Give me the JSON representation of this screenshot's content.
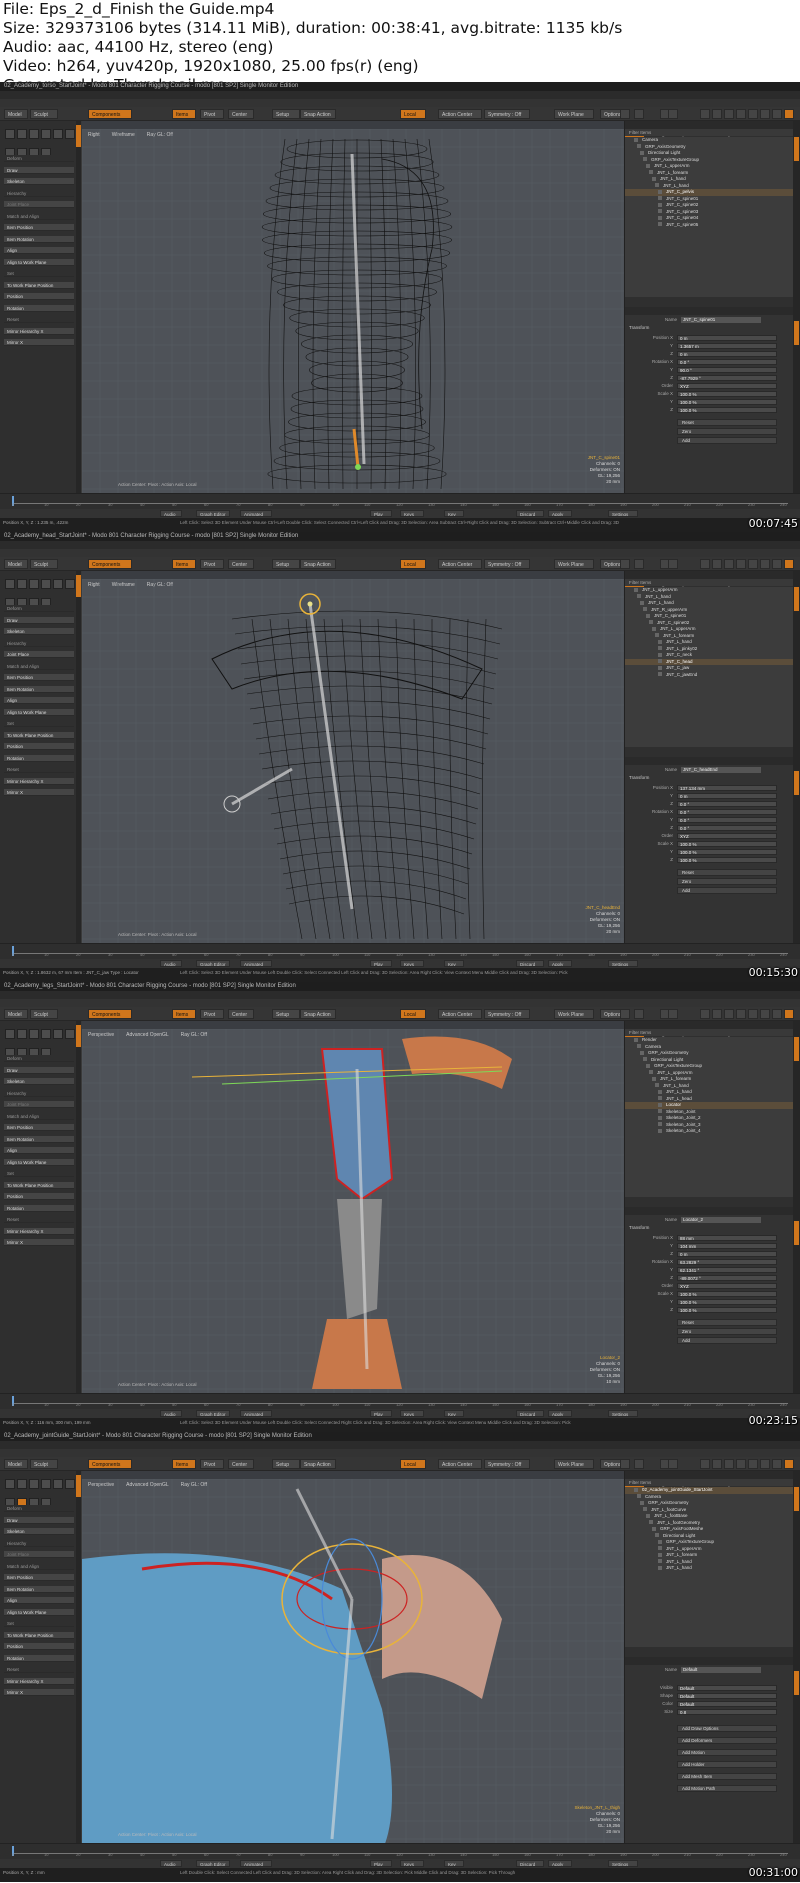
{
  "header": {
    "lines": [
      "File: Eps_2_d_Finish the Guide.mp4",
      "Size: 329373106 bytes (314.11 MiB), duration: 00:38:41, avg.bitrate: 1135 kb/s",
      "Audio: aac, 44100 Hz, stereo (eng)",
      "Video: h264, yuv420p, 1920x1080, 25.00 fps(r) (eng)",
      "Generated by Thumbnail me"
    ]
  },
  "app": {
    "menu": [
      "File",
      "Edit",
      "View",
      "Select",
      "Item",
      "Geometry",
      "Texture",
      "Vertex Map",
      "Animate",
      "Dynamics",
      "Render",
      "MTK",
      "Layout",
      "System",
      "Help"
    ],
    "layout_tabs": [
      "Model",
      "Model Quad",
      "Topo",
      "UV",
      "Paint",
      "Sculpt",
      "Setup",
      "Animate",
      "Render"
    ],
    "toolbar": {
      "model": "Model",
      "sculpt": "Sculpt",
      "components": "Components",
      "items": "Items",
      "pivot": "Pivot",
      "center": "Center",
      "setup": "Setup",
      "snap": "Snap Action",
      "actr": "Action Center",
      "local": "Local",
      "symmetry": "Symmetry : Off",
      "work_plane": "Work Plane",
      "options": "Options"
    },
    "toolpanel": [
      "Deform",
      "Draw",
      "Skeleton",
      "Hierarchy",
      "Joint Place",
      "Match and Align",
      "Item Position",
      "Item Rotation",
      "Align",
      "Align to Work Plane",
      "Set",
      "To Work Plane Position",
      "Position",
      "Rotation",
      "Reset",
      "Mirror Hierarchy X",
      "Mirror X"
    ],
    "right_tabs": [
      "Items",
      "Shading",
      "Groups",
      "Info",
      "Assembly"
    ],
    "prop_tabs": [
      "Properties",
      "Channels",
      "Display",
      "User",
      "Assembly"
    ],
    "filter_label": "Filter Items",
    "transform_label": "Transform",
    "name_label": "Name",
    "prop_labels": [
      "Position X",
      "Y",
      "Z",
      "Rotation X",
      "Y",
      "Z",
      "Order",
      "Scale X",
      "Y",
      "Z"
    ],
    "buttons": [
      "Reset",
      "Zero",
      "Add"
    ],
    "transport": [
      "Audio",
      "Graph Editor",
      "Animated",
      "Play",
      "Keys",
      "Key",
      "Discard",
      "Apply",
      "Settings"
    ],
    "center_text": "Action Center: Pivot : Action Axis: Local"
  },
  "frames": [
    {
      "title": "02_Academy_torso_StartJoint* - Modo 801 Character Rigging Course - modo [801 SP2] Single Monitor Edition",
      "viewport_tabs": [
        "Right",
        "Wireframe",
        "Ray GL: Off"
      ],
      "tree": [
        "Camera",
        "GRP_AxisGeometry",
        "Directional Light",
        "GRP_AxisTextureGroup",
        "JNT_L_upperArm",
        "JNT_L_forearm",
        "JNT_L_hand",
        "JNT_L_hand",
        "JNT_C_pelvis",
        "JNT_C_spine01",
        "JNT_C_spine02",
        "JNT_C_spine03",
        "JNT_C_spine04",
        "JNT_C_spine05"
      ],
      "selected": 8,
      "item_name": "JNT_C_spine01",
      "props": [
        "0 m",
        "1.3657 m",
        "0 m",
        "0.0 °",
        "90.0 °",
        "-87.7929 °",
        "XYZ",
        "100.0 %",
        "100.0 %",
        "100.0 %"
      ],
      "vp_info": [
        "JNT_C_spine01",
        "Channels: 0",
        "Deformers: ON",
        "GL: 19,256",
        "20 mm"
      ],
      "status_pos": "Position X, Y, Z :  1.235 m,  .422m",
      "hint": "Left Click: Select 3D Element Under Mouse  Ctrl+Left Double Click: Select Connected  Ctrl+Left Click and Drag: 3D Selection: Area Subtract  Ctrl+Right Click and Drag: 3D Selection: Subtract  Ctrl+Middle Click and Drag: 3D Selection: Subtract Through",
      "timecode": "00:07:45"
    },
    {
      "title": "02_Academy_head_StartJoint* - Modo 801 Character Rigging Course - modo [801 SP2] Single Monitor Edition",
      "viewport_tabs": [
        "Right",
        "Wireframe",
        "Ray GL: Off"
      ],
      "tree": [
        "JNT_L_upperArm",
        "JNT_L_hand",
        "JNT_L_hand",
        "JNT_R_upperArm",
        "JNT_C_spine01",
        "JNT_C_spine02",
        "JNT_L_upperArm",
        "JNT_L_forearm",
        "JNT_L_hand",
        "JNT_L_pinky02",
        "JNT_C_neck",
        "JNT_C_head",
        "JNT_C_jaw",
        "JNT_C_jawEnd"
      ],
      "selected": 11,
      "item_name": "JNT_C_headEnd",
      "props": [
        "137.134 mm",
        "0 m",
        "0.0 °",
        "0.0 °",
        "0.0 °",
        "0.0 °",
        "XYZ",
        "100.0 %",
        "100.0 %",
        "100.0 %"
      ],
      "vp_info": [
        "JNT_C_headEnd",
        "Channels: 0",
        "Deformers: ON",
        "GL: 19,256",
        "20 mm"
      ],
      "status_pos": "Position X, Y, Z :  1.8632 m,  67 mm  Item : JNT_C_jaw  Type : Locator",
      "hint": "Left Click: Select 3D Element Under Mouse  Left Double Click: Select Connected  Left Click and Drag: 3D Selection: Area  Right Click: View Context Menu  Middle Click and Drag: 3D Selection: Pick",
      "timecode": "00:15:30"
    },
    {
      "title": "02_Academy_legs_StartJoint* - Modo 801 Character Rigging Course - modo [801 SP2] Single Monitor Edition",
      "viewport_tabs": [
        "Perspective",
        "Advanced OpenGL",
        "Ray GL: Off"
      ],
      "tree": [
        "Render",
        "Camera",
        "GRP_AxisGeometry",
        "Directional Light",
        "GRP_AxisTextureGroup",
        "JNT_L_upperArm",
        "JNT_L_forearm",
        "JNT_L_hand",
        "JNT_L_hand",
        "JNT_L_head",
        "Locator",
        "Skeleton_Joint",
        "Skeleton_Joint_2",
        "Skeleton_Joint_3",
        "Skeleton_Joint_4"
      ],
      "selected": 10,
      "item_name": "Locator_2",
      "props": [
        "88 mm",
        "104 mm",
        "0 m",
        "63.2829 °",
        "62.1341 °",
        "-89.0072 °",
        "XYZ",
        "100.0 %",
        "100.0 %",
        "100.0 %"
      ],
      "vp_info": [
        "Locator_2",
        "Channels: 0",
        "Deformers: ON",
        "GL: 19,256",
        "10 mm"
      ],
      "status_pos": "Position X, Y, Z :  116 mm,  300 mm,  199 mm",
      "hint": "Left Click: Select 3D Element Under Mouse  Left Double Click: Select Connected  Right Click and Drag: 3D Selection: Area  Right Click: View Context Menu  Middle Click and Drag: 3D Selection: Pick",
      "timecode": "00:23:15"
    },
    {
      "title": "02_Academy_jointGuide_StartJoint* - Modo 801 Character Rigging Course - modo [801 SP2] Single Monitor Edition",
      "viewport_tabs": [
        "Perspective",
        "Advanced OpenGL",
        "Ray GL: Off"
      ],
      "tree": [
        "02_Academy_jointGuide_StartJoint",
        "Camera",
        "GRP_AxisGeometry",
        "JNT_L_footCurve",
        "JNT_L_footBase",
        "JNT_L_footGeometry",
        "GRP_AxisFootMeshe",
        "Directional Light",
        "GRP_AxisTextureGroup",
        "JNT_L_upperArm",
        "JNT_L_forearm",
        "JNT_L_hand",
        "JNT_L_hand"
      ],
      "selected": 0,
      "item_name": "Default",
      "props": [
        "Default",
        "Default",
        "Default",
        "0.8"
      ],
      "prop_labels": [
        "Visible",
        "Shape",
        "Color",
        "Size"
      ],
      "buttons": [
        "Add Draw Options",
        "Add Deformers",
        "Add Motion",
        "Add Holder",
        "Add Mesh Item",
        "Add Motion Path"
      ],
      "vp_info": [
        "Skeleton_JNT_L_thigh",
        "Channels: 0",
        "Deformers: ON",
        "GL: 19,256",
        "20 mm"
      ],
      "status_pos": "Position X, Y, Z :  mm",
      "hint": "Left Double Click: Select Connected  Left Click and Drag: 3D Selection: Area  Right Click and Drag: 3D Selection: Pick  Middle Click and Drag: 3D Selection: Pick Through",
      "timecode": "00:31:00"
    }
  ]
}
